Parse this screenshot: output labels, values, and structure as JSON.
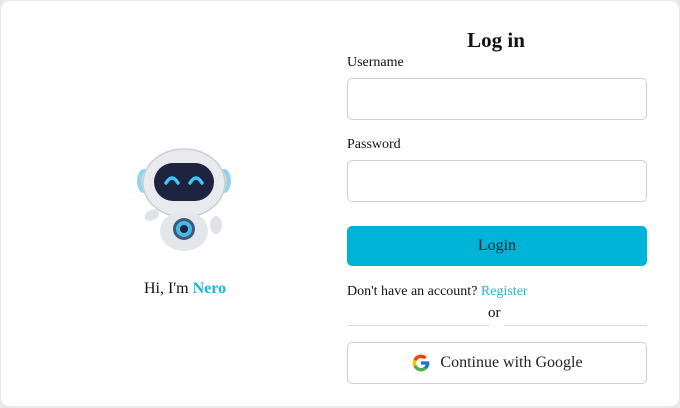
{
  "left_panel": {
    "greeting_prefix": "Hi, I'm ",
    "assistant_name": "Nero"
  },
  "form": {
    "title": "Log in",
    "username_label": "Username",
    "username_value": "",
    "password_label": "Password",
    "password_value": "",
    "login_button": "Login",
    "no_account_text": "Don't have an account? ",
    "register_link": "Register",
    "or_text": "or",
    "google_button": "Continue with Google"
  },
  "colors": {
    "accent": "#00b4d8",
    "link": "#1fb6d2",
    "background": "#e9e9ec"
  },
  "icons": {
    "robot": "robot-mascot-icon",
    "google": "google-g-icon"
  }
}
